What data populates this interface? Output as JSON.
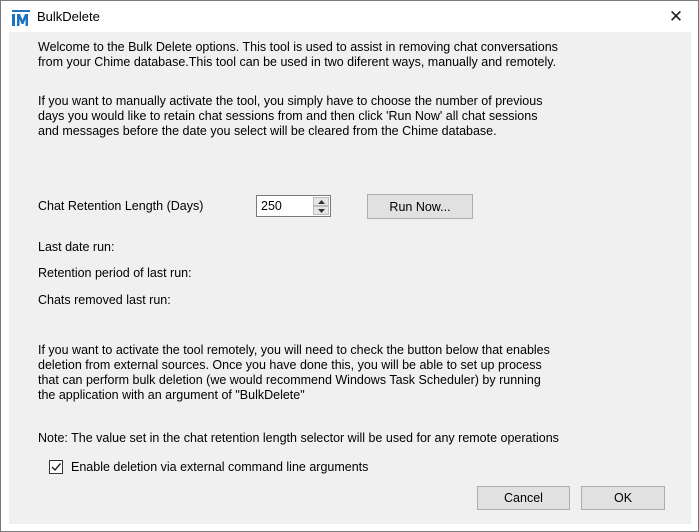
{
  "window": {
    "title": "BulkDelete",
    "icon": "app-logo-icon",
    "close_icon": "close-icon",
    "close_glyph": "✕"
  },
  "intro": {
    "paragraph1": "Welcome to the Bulk Delete options. This tool is used to assist in removing chat conversations\nfrom your Chime database.This tool can be used in two diferent ways, manually and remotely.",
    "paragraph2": "If you want to manually activate the tool, you simply have to choose the number of previous\ndays you would like to retain chat sessions from and then click 'Run Now' all chat sessions\nand messages before the date you select will be cleared from the Chime database."
  },
  "retention": {
    "label": "Chat Retention Length (Days)",
    "value": "250",
    "run_now_label": "Run Now..."
  },
  "status": {
    "last_date_run": "Last date run:",
    "retention_period": "Retention period of last run:",
    "chats_removed": "Chats removed last run:"
  },
  "remote": {
    "paragraph": "If you want to activate the tool remotely, you will need to check the button below that enables\ndeletion from external sources. Once you have done this, you will be able to set up process\nthat can perform bulk deletion (we would recommend Windows Task Scheduler) by running\nthe application with an argument of \"BulkDelete\"",
    "note": "Note: The value set in the chat retention length selector will be used for any remote operations",
    "checkbox_label": "Enable deletion via external command line arguments",
    "checkbox_checked": true
  },
  "buttons": {
    "cancel": "Cancel",
    "ok": "OK"
  },
  "colors": {
    "client_bg": "#f0f0f0",
    "button_bg": "#e1e1e1",
    "logo_blue": "#1e73be"
  }
}
